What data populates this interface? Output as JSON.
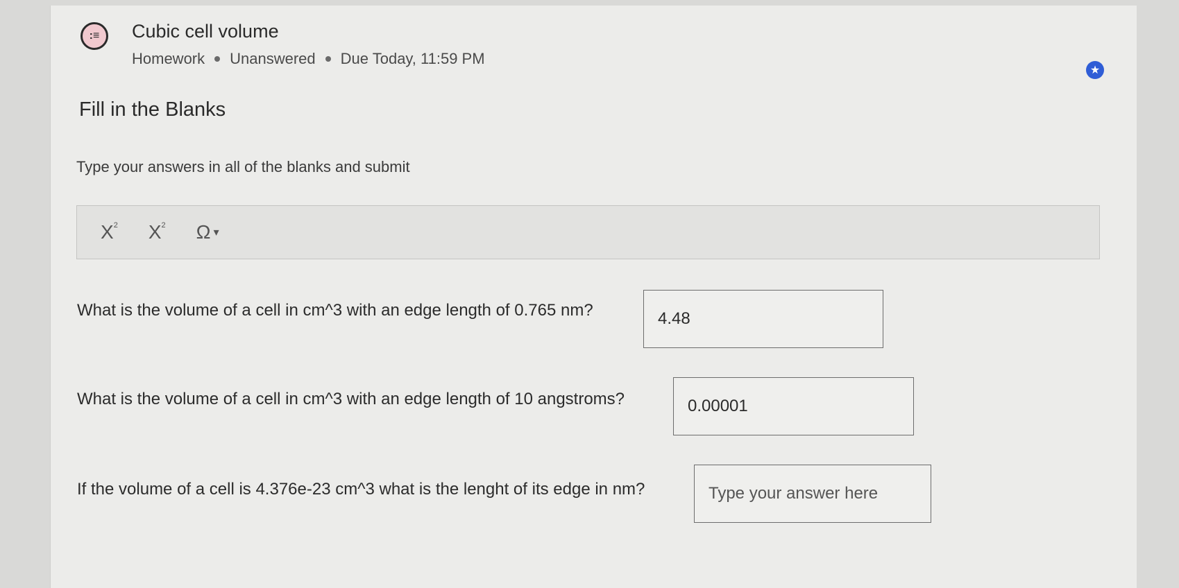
{
  "header": {
    "title": "Cubic cell volume",
    "meta": [
      "Homework",
      "Unanswered",
      "Due Today, 11:59 PM"
    ],
    "icon": "list-bubble-icon"
  },
  "section_title": "Fill in the Blanks",
  "instructions": "Type your answers in all of the blanks and submit",
  "toolbar": {
    "subscript": "X",
    "subscript_mark": "2",
    "superscript": "X",
    "superscript_mark": "2",
    "symbol": "Ω"
  },
  "questions": [
    {
      "text": "What is the volume of a cell in cm^3 with an edge length of 0.765 nm?",
      "answer": "4.48"
    },
    {
      "text": "What is the volume of a cell in cm^3 with an edge length of 10 angstroms?",
      "answer": "0.00001"
    },
    {
      "text": "If the volume of a cell is  4.376e-23 cm^3 what is the lenght of its edge in nm?",
      "answer": "",
      "placeholder": "Type your answer here"
    }
  ],
  "colors": {
    "accent": "#2f5dd6",
    "icon_fill": "#f1c9cf"
  }
}
